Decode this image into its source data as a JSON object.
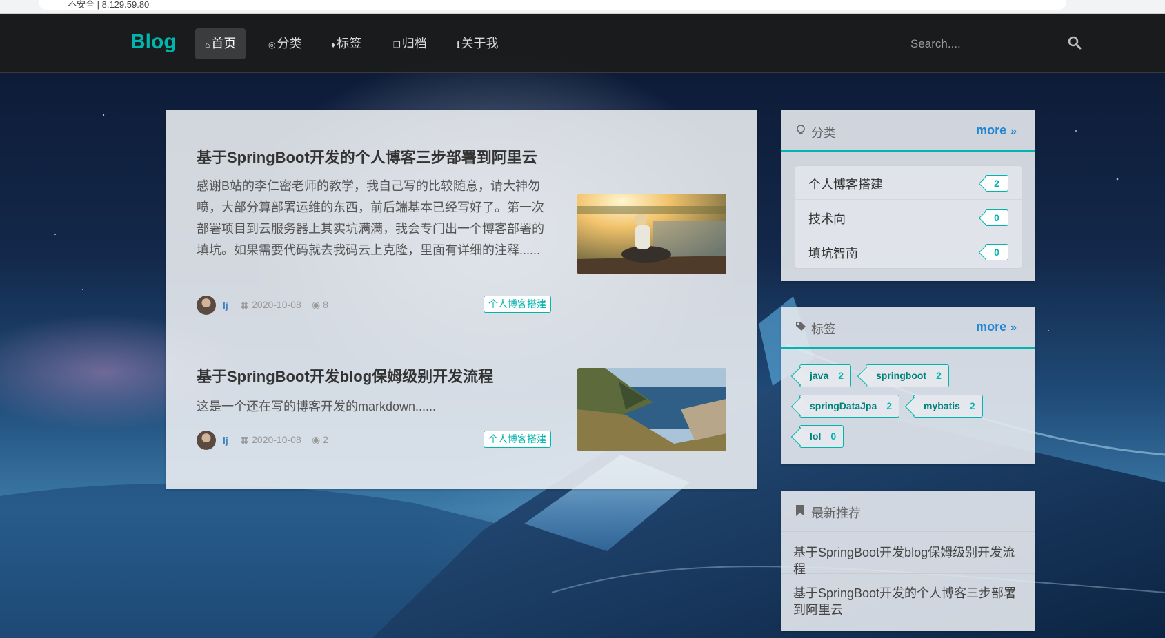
{
  "browser": {
    "url_text": "不安全 | 8.129.59.80"
  },
  "nav": {
    "brand": "Blog",
    "items": [
      {
        "label": "首页",
        "icon": "home-icon",
        "active": true
      },
      {
        "label": "分类",
        "icon": "lightbulb-icon",
        "active": false
      },
      {
        "label": "标签",
        "icon": "tags-icon",
        "active": false
      },
      {
        "label": "归档",
        "icon": "clone-icon",
        "active": false
      },
      {
        "label": "关于我",
        "icon": "info-icon",
        "active": false
      }
    ],
    "search_placeholder": "Search...."
  },
  "posts": [
    {
      "title": "基于SpringBoot开发的个人博客三步部署到阿里云",
      "excerpt": "感谢B站的李仁密老师的教学，我自己写的比较随意，请大神勿喷，大部分算部署运维的东西，前后端基本已经写好了。第一次部署项目到云服务器上其实坑满满，我会专门出一个博客部署的填坑。如果需要代码就去我码云上克隆，里面有详细的注释......",
      "author": "lj",
      "date": "2020-10-08",
      "views": "8",
      "category": "个人博客搭建",
      "image": "woman-by-lake-photo"
    },
    {
      "title": "基于SpringBoot开发blog保姆级别开发流程",
      "excerpt": "这是一个还在写的博客开发的markdown......",
      "author": "lj",
      "date": "2020-10-08",
      "views": "2",
      "category": "个人博客搭建",
      "image": "coastal-cliff-photo"
    }
  ],
  "categories_card": {
    "title": "分类",
    "more": "more",
    "items": [
      {
        "name": "个人博客搭建",
        "count": "2"
      },
      {
        "name": "技术向",
        "count": "0"
      },
      {
        "name": "填坑智南",
        "count": "0"
      }
    ]
  },
  "tags_card": {
    "title": "标签",
    "more": "more",
    "items": [
      {
        "name": "java",
        "count": "2"
      },
      {
        "name": "springboot",
        "count": "2"
      },
      {
        "name": "springDataJpa",
        "count": "2"
      },
      {
        "name": "mybatis",
        "count": "2"
      },
      {
        "name": "lol",
        "count": "0"
      }
    ]
  },
  "recommend_card": {
    "title": "最新推荐",
    "items": [
      "基于SpringBoot开发blog保姆级别开发流程",
      "基于SpringBoot开发的个人博客三步部署到阿里云"
    ]
  },
  "colors": {
    "accent": "#00b5ad",
    "link": "#2185d0",
    "nav_bg": "#1b1c1d"
  }
}
